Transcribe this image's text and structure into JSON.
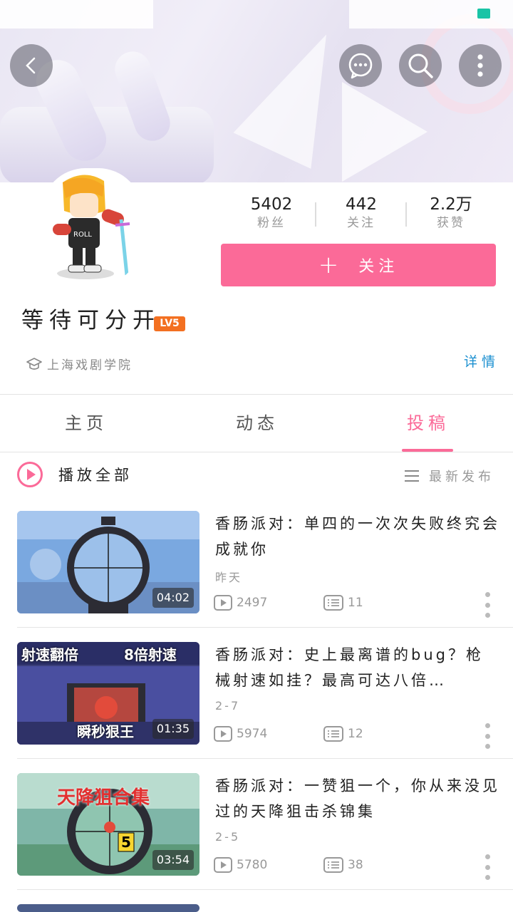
{
  "header": {
    "back_icon": "back-arrow-icon",
    "message_icon": "chat-bubble-icon",
    "search_icon": "search-icon",
    "more_icon": "more-vertical-icon"
  },
  "profile": {
    "username": "等待可分开",
    "level": "LV5",
    "school": "上海戏剧学院",
    "detail_link": "详情",
    "follow_label": "关注",
    "stats": [
      {
        "value": "5402",
        "label": "粉丝"
      },
      {
        "value": "442",
        "label": "关注"
      },
      {
        "value": "2.2万",
        "label": "获赞"
      }
    ]
  },
  "tabs": [
    {
      "label": "主页"
    },
    {
      "label": "动态"
    },
    {
      "label": "投稿"
    }
  ],
  "active_tab": "投稿",
  "toolbar": {
    "play_all": "播放全部",
    "sort_label": "最新发布"
  },
  "videos": [
    {
      "title": "香肠派对：单四的一次次失败终究会成就你",
      "date": "昨天",
      "duration": "04:02",
      "views": "2497",
      "comments": "11"
    },
    {
      "title": "香肠派对：史上最离谱的bug？枪械射速如挂？最高可达八倍…",
      "date": "2-7",
      "duration": "01:35",
      "views": "5974",
      "comments": "12",
      "thumb_text_left": "射速翻倍",
      "thumb_text_right": "8倍射速",
      "thumb_text_bottom": "瞬秒狠王"
    },
    {
      "title": "香肠派对：一赞狙一个，你从来没见过的天降狙击杀锦集",
      "date": "2-5",
      "duration": "03:54",
      "views": "5780",
      "comments": "38",
      "thumb_text_top": "天降狙合集"
    }
  ],
  "colors": {
    "accent": "#fb6a98",
    "link": "#1a8fd0",
    "level": "#f37021"
  }
}
